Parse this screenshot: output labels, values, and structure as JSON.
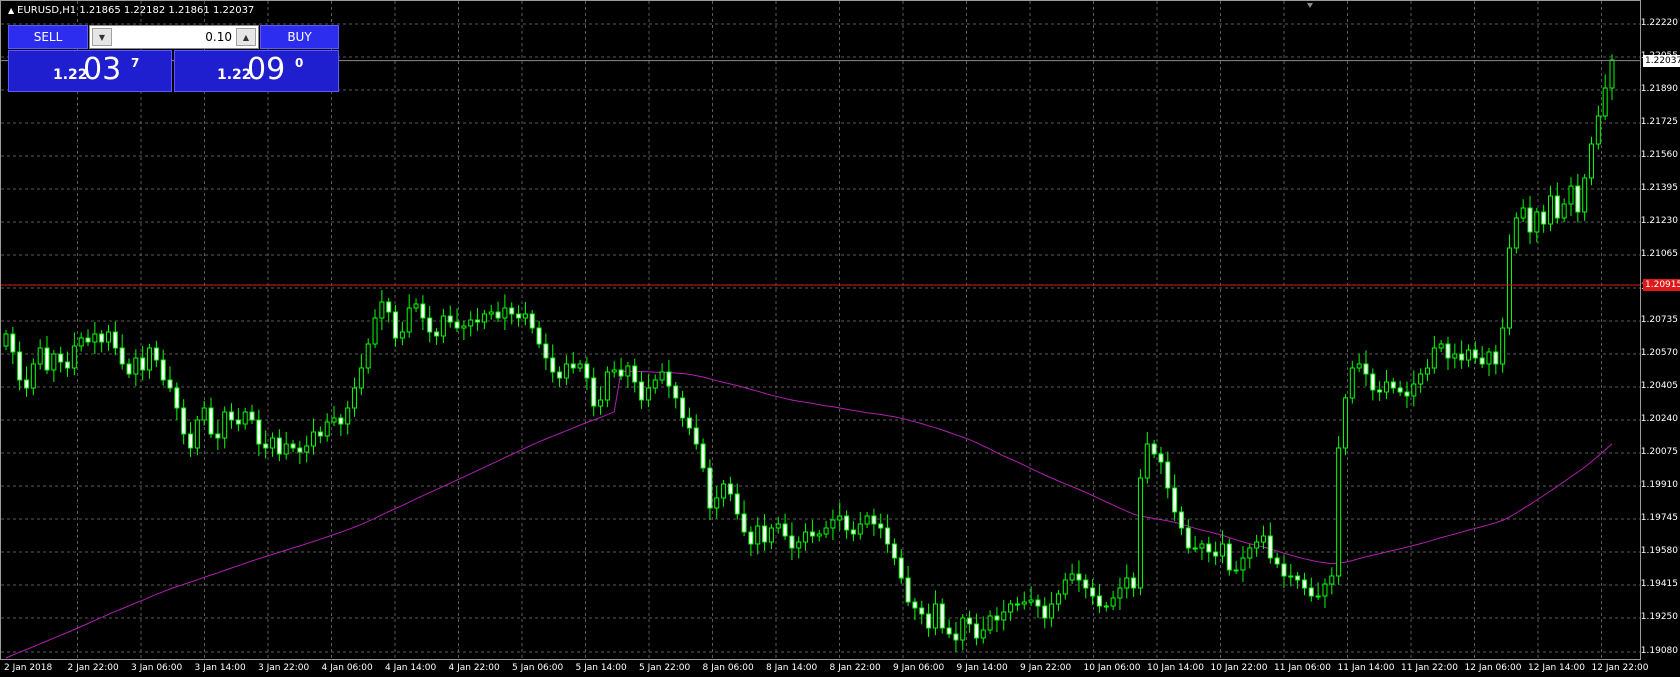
{
  "window": {
    "title": "EURUSD,H1  1.21865 1.22182 1.21861 1.22037"
  },
  "trade_panel": {
    "sell_label": "SELL",
    "buy_label": "BUY",
    "lot": "0.10",
    "sell_quote": {
      "prefix": "1.22",
      "big": "03",
      "sup": "7"
    },
    "buy_quote": {
      "prefix": "1.22",
      "big": "09",
      "sup": "0"
    }
  },
  "colors": {
    "background": "#000000",
    "grid": "#5a5a5a",
    "candle": "#00ff00",
    "bull_body": "#000000",
    "bear_body": "#ffffff",
    "ma": "#b020b0",
    "hline": "#e01818",
    "bidline": "#8c8c8c"
  },
  "chart_data": {
    "type": "candlestick",
    "symbol": "EURUSD",
    "timeframe": "H1",
    "ohlc": {
      "open": 1.21865,
      "high": 1.22182,
      "low": 1.21861,
      "close": 1.22037
    },
    "ylim": [
      1.1908,
      1.22262
    ],
    "y_ticks": [
      "1.22220",
      "1.22055",
      "1.21890",
      "1.21725",
      "1.21560",
      "1.21395",
      "1.21230",
      "1.21065",
      "1.20900",
      "1.20735",
      "1.20570",
      "1.20405",
      "1.20240",
      "1.20075",
      "1.19910",
      "1.19745",
      "1.19580",
      "1.19415",
      "1.19250",
      "1.19080"
    ],
    "x_ticks": [
      "2 Jan 2018",
      "2 Jan 22:00",
      "3 Jan 06:00",
      "3 Jan 14:00",
      "3 Jan 22:00",
      "4 Jan 06:00",
      "4 Jan 14:00",
      "4 Jan 22:00",
      "5 Jan 06:00",
      "5 Jan 14:00",
      "5 Jan 22:00",
      "8 Jan 06:00",
      "8 Jan 14:00",
      "8 Jan 22:00",
      "9 Jan 06:00",
      "9 Jan 14:00",
      "9 Jan 22:00",
      "10 Jan 06:00",
      "10 Jan 14:00",
      "10 Jan 22:00",
      "11 Jan 06:00",
      "11 Jan 14:00",
      "11 Jan 22:00",
      "12 Jan 06:00",
      "12 Jan 14:00",
      "12 Jan 22:00"
    ],
    "bid_price": "1.22037",
    "horizontal_line": "1.20915",
    "closes": [
      1.2067,
      1.2058,
      1.2044,
      1.204,
      1.2052,
      1.206,
      1.2049,
      1.2057,
      1.2053,
      1.205,
      1.2061,
      1.2065,
      1.2063,
      1.2067,
      1.2063,
      1.2068,
      1.206,
      1.2052,
      1.2047,
      1.2055,
      1.2049,
      1.206,
      1.2054,
      1.2044,
      1.204,
      1.203,
      1.2017,
      1.201,
      1.2024,
      1.203,
      1.2017,
      1.2015,
      1.2028,
      1.2024,
      1.2022,
      1.2028,
      1.2024,
      1.2012,
      1.201,
      1.2015,
      1.2007,
      1.2012,
      1.201,
      1.2008,
      1.2011,
      1.2018,
      1.2016,
      1.2023,
      1.2025,
      1.2022,
      1.203,
      1.204,
      1.205,
      1.2062,
      1.2075,
      1.2083,
      1.2078,
      1.2065,
      1.2068,
      1.208,
      1.2082,
      1.2075,
      1.2068,
      1.2066,
      1.2076,
      1.2073,
      1.207,
      1.2071,
      1.2074,
      1.2073,
      1.2077,
      1.2078,
      1.2075,
      1.208,
      1.2077,
      1.2075,
      1.2077,
      1.207,
      1.2062,
      1.2055,
      1.2048,
      1.2045,
      1.2052,
      1.205,
      1.2052,
      1.2045,
      1.2031,
      1.2034,
      1.2048,
      1.2049,
      1.2046,
      1.2051,
      1.2043,
      1.2034,
      1.204,
      1.2044,
      1.2048,
      1.2041,
      1.2035,
      1.2025,
      1.202,
      1.2012,
      1.2,
      1.198,
      1.1985,
      1.1992,
      1.1987,
      1.1977,
      1.1968,
      1.1962,
      1.1971,
      1.1963,
      1.197,
      1.1972,
      1.1966,
      1.196,
      1.1963,
      1.1968,
      1.1966,
      1.1967,
      1.197,
      1.1974,
      1.1976,
      1.1969,
      1.1967,
      1.1972,
      1.1976,
      1.1972,
      1.197,
      1.1962,
      1.1955,
      1.1945,
      1.1933,
      1.193,
      1.1927,
      1.192,
      1.1932,
      1.192,
      1.1917,
      1.1914,
      1.1925,
      1.1922,
      1.1915,
      1.1919,
      1.1926,
      1.1924,
      1.1928,
      1.1932,
      1.1932,
      1.1933,
      1.1934,
      1.1931,
      1.1925,
      1.1932,
      1.1937,
      1.1944,
      1.1947,
      1.1944,
      1.194,
      1.1936,
      1.1931,
      1.1931,
      1.1935,
      1.194,
      1.1945,
      1.194,
      1.1995,
      1.2012,
      1.2007,
      1.2003,
      1.199,
      1.1978,
      1.197,
      1.196,
      1.196,
      1.1962,
      1.1958,
      1.1956,
      1.1962,
      1.1949,
      1.1949,
      1.1955,
      1.196,
      1.1963,
      1.1966,
      1.1955,
      1.1952,
      1.1946,
      1.1946,
      1.1944,
      1.194,
      1.1936,
      1.1936,
      1.1942,
      1.1946,
      1.201,
      1.2035,
      1.205,
      1.2052,
      1.2047,
      1.2039,
      1.2038,
      1.2043,
      1.204,
      1.2038,
      1.2036,
      1.2042,
      1.2047,
      1.205,
      1.206,
      1.2062,
      1.2055,
      1.2057,
      1.2054,
      1.2059,
      1.2055,
      1.2052,
      1.2058,
      1.2052,
      1.207,
      1.211,
      1.2125,
      1.213,
      1.2118,
      1.2128,
      1.2122,
      1.2136,
      1.2125,
      1.2132,
      1.2141,
      1.2128,
      1.2145,
      1.2162,
      1.2176,
      1.219,
      1.2204
    ]
  }
}
